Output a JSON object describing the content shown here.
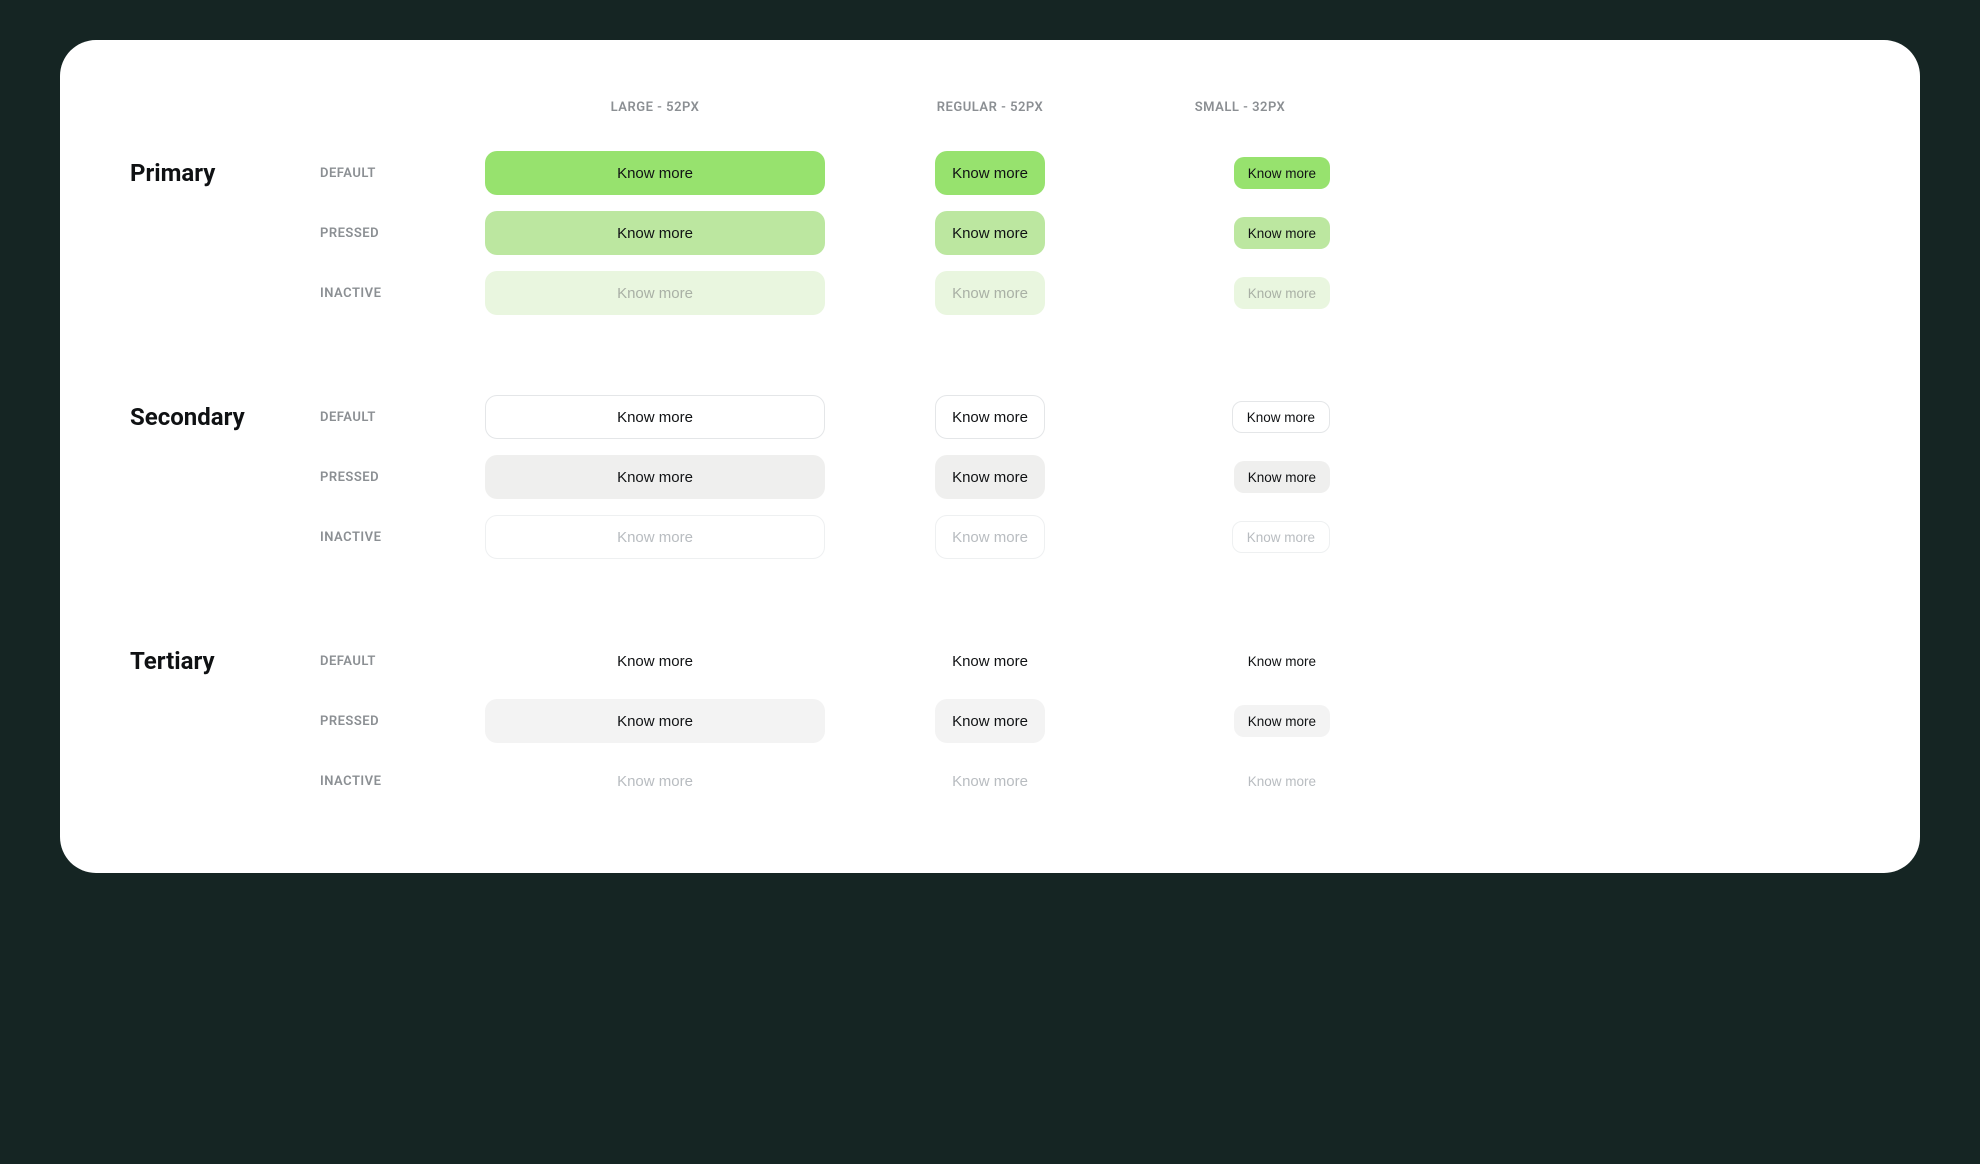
{
  "columns": {
    "large": "LARGE - 52PX",
    "regular": "REGULAR - 52PX",
    "small": "SMALL - 32PX"
  },
  "variants": [
    {
      "title": "Primary",
      "rows": [
        {
          "state": "DEFAULT",
          "label": "Know more"
        },
        {
          "state": "PRESSED",
          "label": "Know more"
        },
        {
          "state": "INACTIVE",
          "label": "Know more"
        }
      ]
    },
    {
      "title": "Secondary",
      "rows": [
        {
          "state": "DEFAULT",
          "label": "Know more"
        },
        {
          "state": "PRESSED",
          "label": "Know more"
        },
        {
          "state": "INACTIVE",
          "label": "Know more"
        }
      ]
    },
    {
      "title": "Tertiary",
      "rows": [
        {
          "state": "DEFAULT",
          "label": "Know more"
        },
        {
          "state": "PRESSED",
          "label": "Know more"
        },
        {
          "state": "INACTIVE",
          "label": "Know more"
        }
      ]
    }
  ]
}
